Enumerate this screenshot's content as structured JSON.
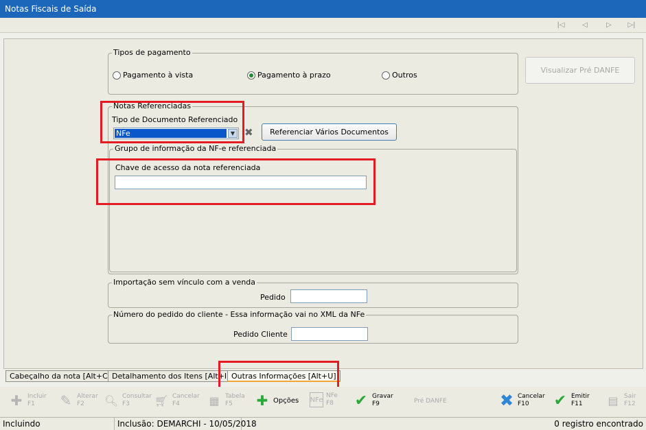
{
  "window": {
    "title": "Notas Fiscais de Saída"
  },
  "nav": {
    "first": "first",
    "prev": "previous",
    "next": "next",
    "last": "last"
  },
  "payment": {
    "legend": "Tipos de pagamento",
    "options": [
      "Pagamento à vista",
      "Pagamento à prazo",
      "Outros"
    ],
    "selected": "Pagamento à prazo"
  },
  "preview_button": "Visualizar Pré DANFE",
  "referenced": {
    "legend": "Notas Referenciadas",
    "doc_type_label": "Tipo de Documento Referenciado",
    "doc_type_value": "NFe",
    "multi_button": "Referenciar Vários Documentos",
    "group_legend": "Grupo de informação da NF-e referenciada",
    "key_label": "Chave de acesso da nota referenciada",
    "key_value": ""
  },
  "import": {
    "legend": "Importação sem vínculo com a venda",
    "order_label": "Pedido",
    "order_value": ""
  },
  "client_order": {
    "legend": "Número do pedido do cliente - Essa informação vai no XML da NFe",
    "label": "Pedido Cliente",
    "value": ""
  },
  "tabs": [
    {
      "label": "Cabeçalho da nota  [Alt+C]"
    },
    {
      "label": "Detalhamento dos Itens  [Alt+I]"
    },
    {
      "label": "Outras Informações  [Alt+U]"
    }
  ],
  "toolbar": {
    "incluir": {
      "label": "Incluir",
      "key": "F1"
    },
    "alterar": {
      "label": "Alterar",
      "key": "F2"
    },
    "consultar": {
      "label": "Consultar",
      "key": "F3"
    },
    "cancelar4": {
      "label": "Cancelar",
      "key": "F4"
    },
    "tabela": {
      "label": "Tabela",
      "key": "F5"
    },
    "opcoes": {
      "label": "Opções"
    },
    "nfe": {
      "label": "NFe",
      "key": "F8"
    },
    "gravar": {
      "label": "Gravar",
      "key": "F9"
    },
    "pre_danfe": {
      "label": "Pré DANFE"
    },
    "cancelar10": {
      "label": "Cancelar",
      "key": "F10"
    },
    "emitir": {
      "label": "Emitir",
      "key": "F11"
    },
    "sair": {
      "label": "Sair",
      "key": "F12"
    }
  },
  "status": {
    "mode": "Incluindo",
    "inclusion": "Inclusão: DEMARCHI - 10/05/2018",
    "records": "0 registro encontrado"
  },
  "colors": {
    "title_bar": "#1c67b9",
    "highlight": "#e31b23",
    "selection": "#0a57c9",
    "check_green": "#2aa838"
  }
}
